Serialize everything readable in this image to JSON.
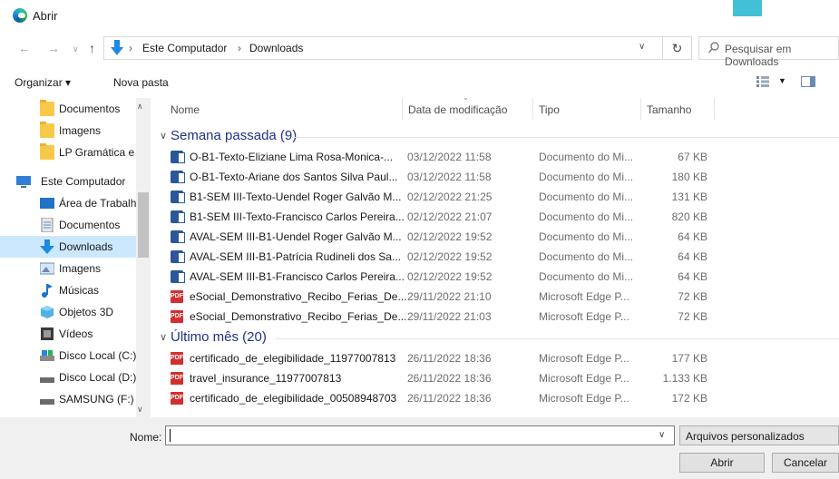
{
  "window": {
    "title": "Abrir"
  },
  "nav": {
    "back": "←",
    "forward": "→",
    "recent": "∨",
    "up": "↑",
    "breadcrumb": [
      "Este Computador",
      "Downloads"
    ],
    "sep": "›",
    "refresh": "↻",
    "search_placeholder": "Pesquisar em Downloads"
  },
  "toolbar": {
    "organize": "Organizar ▾",
    "new_folder": "Nova pasta"
  },
  "sidebar": {
    "items": [
      {
        "label": "Documentos",
        "icon": "folder-icon"
      },
      {
        "label": "Imagens",
        "icon": "folder-icon"
      },
      {
        "label": "LP Gramática e L",
        "icon": "link-folder-icon"
      },
      {
        "label": "Este Computador",
        "icon": "computer-icon"
      },
      {
        "label": "Área de Trabalho",
        "icon": "desktop-icon"
      },
      {
        "label": "Documentos",
        "icon": "documents-icon"
      },
      {
        "label": "Downloads",
        "icon": "downloads-icon"
      },
      {
        "label": "Imagens",
        "icon": "pictures-icon"
      },
      {
        "label": "Músicas",
        "icon": "music-icon"
      },
      {
        "label": "Objetos 3D",
        "icon": "objects-3d-icon"
      },
      {
        "label": "Vídeos",
        "icon": "videos-icon"
      },
      {
        "label": "Disco Local (C:)",
        "icon": "drive-c-icon"
      },
      {
        "label": "Disco Local (D:)",
        "icon": "drive-icon"
      },
      {
        "label": "SAMSUNG (F:)",
        "icon": "usb-drive-icon"
      }
    ]
  },
  "columns": {
    "name": "Nome",
    "date": "Data de modificação",
    "type": "Tipo",
    "size": "Tamanho"
  },
  "groups": [
    {
      "label": "Semana passada (9)"
    },
    {
      "label": "Último mês (20)"
    }
  ],
  "files_week": [
    {
      "name": "O-B1-Texto-Eliziane Lima Rosa-Monica-...",
      "date": "03/12/2022 11:58",
      "type": "Documento do Mi...",
      "size": "67 KB",
      "kind": "word"
    },
    {
      "name": "O-B1-Texto-Ariane dos Santos Silva Paul...",
      "date": "03/12/2022 11:58",
      "type": "Documento do Mi...",
      "size": "180 KB",
      "kind": "word"
    },
    {
      "name": "B1-SEM III-Texto-Uendel Roger Galvão M...",
      "date": "02/12/2022 21:25",
      "type": "Documento do Mi...",
      "size": "131 KB",
      "kind": "word"
    },
    {
      "name": "B1-SEM III-Texto-Francisco Carlos Pereira...",
      "date": "02/12/2022 21:07",
      "type": "Documento do Mi...",
      "size": "820 KB",
      "kind": "word"
    },
    {
      "name": "AVAL-SEM III-B1-Uendel Roger Galvão M...",
      "date": "02/12/2022 19:52",
      "type": "Documento do Mi...",
      "size": "64 KB",
      "kind": "word"
    },
    {
      "name": "AVAL-SEM III-B1-Patrícia Rudineli dos Sa...",
      "date": "02/12/2022 19:52",
      "type": "Documento do Mi...",
      "size": "64 KB",
      "kind": "word"
    },
    {
      "name": "AVAL-SEM III-B1-Francisco Carlos Pereira...",
      "date": "02/12/2022 19:52",
      "type": "Documento do Mi...",
      "size": "64 KB",
      "kind": "word"
    },
    {
      "name": "eSocial_Demonstrativo_Recibo_Ferias_De...",
      "date": "29/11/2022 21:10",
      "type": "Microsoft Edge P...",
      "size": "72 KB",
      "kind": "pdf"
    },
    {
      "name": "eSocial_Demonstrativo_Recibo_Ferias_De...",
      "date": "29/11/2022 21:03",
      "type": "Microsoft Edge P...",
      "size": "72 KB",
      "kind": "pdf"
    }
  ],
  "files_month": [
    {
      "name": "certificado_de_elegibilidade_11977007813",
      "date": "26/11/2022 18:36",
      "type": "Microsoft Edge P...",
      "size": "177 KB",
      "kind": "pdf"
    },
    {
      "name": "travel_insurance_11977007813",
      "date": "26/11/2022 18:36",
      "type": "Microsoft Edge P...",
      "size": "1.133 KB",
      "kind": "pdf"
    },
    {
      "name": "certificado_de_elegibilidade_00508948703",
      "date": "26/11/2022 18:36",
      "type": "Microsoft Edge P...",
      "size": "172 KB",
      "kind": "pdf"
    }
  ],
  "pdf_icon_text": "PDF",
  "footer": {
    "name_label": "Nome:",
    "name_value": "",
    "filetype": "Arquivos personalizados",
    "open": "Abrir",
    "cancel": "Cancelar"
  },
  "colors": {
    "selection": "#cce8ff",
    "group_header": "#1e3287",
    "word": "#2b579a",
    "pdf": "#d32f2f"
  }
}
